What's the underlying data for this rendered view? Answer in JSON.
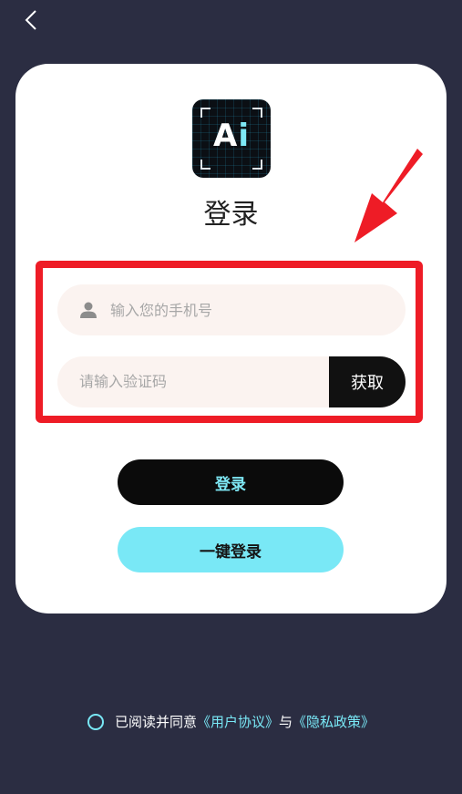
{
  "nav": {
    "back_icon": "chevron-left-icon"
  },
  "logo": {
    "text_a": "A",
    "text_i": "i"
  },
  "page_title": "登录",
  "form": {
    "phone_placeholder": "输入您的手机号",
    "phone_value": "",
    "code_placeholder": "请输入验证码",
    "code_value": "",
    "get_code_label": "获取",
    "user_icon": "user-icon"
  },
  "actions": {
    "login_label": "登录",
    "quick_login_label": "一键登录"
  },
  "agreement": {
    "prefix": "已阅读并同意",
    "user_agreement": "《用户协议》",
    "connector": "与",
    "privacy_policy": "《隐私政策》"
  },
  "colors": {
    "background": "#2b2d42",
    "accent": "#79e8f6",
    "highlight": "#ee1c26",
    "field_bg": "#fbf3f0"
  }
}
